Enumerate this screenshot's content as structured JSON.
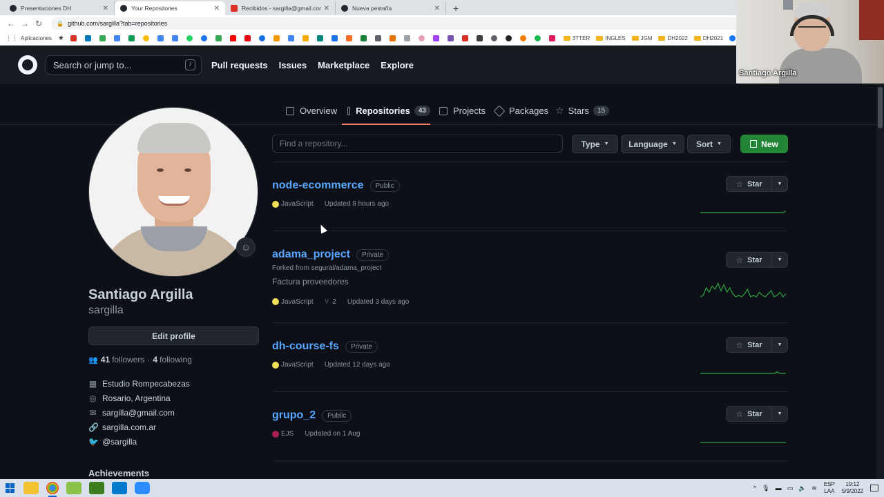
{
  "browser": {
    "tabs": [
      {
        "label": "Presentaciones DH",
        "icon": "github-icon",
        "color": "#24292f",
        "active": false
      },
      {
        "label": "Your Repositories",
        "icon": "github-icon",
        "color": "#24292f",
        "active": true
      },
      {
        "label": "Recibidos - sargilla@gmail.com",
        "icon": "gmail-icon",
        "color": "#d93025",
        "active": false
      },
      {
        "label": "Nueva pestaña",
        "icon": "github-icon",
        "color": "#24292f",
        "active": false
      }
    ],
    "new_tab": "+",
    "close": "✕",
    "url": "github.com/sargilla?tab=repositories",
    "bookmarks": {
      "apps_label": "Aplicaciones",
      "folders": [
        "3TTER",
        "INGLES",
        "JGM",
        "DH2022",
        "DH2021"
      ]
    }
  },
  "github": {
    "search_placeholder": "Search or jump to...",
    "search_key": "/",
    "nav": [
      "Pull requests",
      "Issues",
      "Marketplace",
      "Explore"
    ],
    "profile_tabs": [
      {
        "label": "Overview",
        "count": null
      },
      {
        "label": "Repositories",
        "count": "43"
      },
      {
        "label": "Projects",
        "count": null
      },
      {
        "label": "Packages",
        "count": null
      },
      {
        "label": "Stars",
        "count": "15"
      }
    ]
  },
  "webcam": {
    "name": "Santiago Argilla"
  },
  "profile": {
    "name": "Santiago Argilla",
    "login": "sargilla",
    "edit_label": "Edit profile",
    "followers": "41",
    "followers_label": "followers",
    "following": "4",
    "following_label": "following",
    "dot": "·",
    "company": "Estudio Rompecabezas",
    "location": "Rosario, Argentina",
    "email": "sargilla@gmail.com",
    "website": "sargilla.com.ar",
    "twitter": "@sargilla",
    "achievements": "Achievements"
  },
  "repo_controls": {
    "find_placeholder": "Find a repository...",
    "type_label": "Type",
    "language_label": "Language",
    "sort_label": "Sort",
    "new_label": "New"
  },
  "repos": [
    {
      "name": "node-ecommerce",
      "visibility": "Public",
      "forked_from": "",
      "description": "",
      "language": "JavaScript",
      "lang_color": "#f1e05a",
      "forks": "",
      "updated": "Updated 8 hours ago",
      "star_label": "Star",
      "spark": [
        0,
        0,
        0,
        0,
        0,
        0,
        0,
        0,
        0,
        0,
        0,
        0,
        0,
        0,
        0,
        0,
        0,
        0,
        0,
        0,
        0,
        0,
        0,
        0,
        0,
        0,
        0,
        0,
        0,
        1
      ]
    },
    {
      "name": "adama_project",
      "visibility": "Private",
      "forked_from": "Forked from segural/adama_project",
      "description": "Factura proveedores",
      "language": "JavaScript",
      "lang_color": "#f1e05a",
      "forks": "2",
      "updated": "Updated 3 days ago",
      "star_label": "Star",
      "spark": [
        0,
        1,
        6,
        3,
        7,
        5,
        9,
        4,
        8,
        3,
        6,
        2,
        0,
        1,
        0,
        2,
        5,
        0,
        1,
        0,
        3,
        1,
        0,
        2,
        4,
        0,
        1,
        3,
        0,
        2
      ]
    },
    {
      "name": "dh-course-fs",
      "visibility": "Private",
      "forked_from": "",
      "description": "",
      "language": "JavaScript",
      "lang_color": "#f1e05a",
      "forks": "",
      "updated": "Updated 12 days ago",
      "star_label": "Star",
      "spark": [
        0,
        0,
        0,
        0,
        0,
        0,
        0,
        0,
        0,
        0,
        0,
        0,
        0,
        0,
        0,
        0,
        0,
        0,
        0,
        0,
        0,
        0,
        0,
        0,
        0,
        0,
        1,
        0,
        0,
        0
      ]
    },
    {
      "name": "grupo_2",
      "visibility": "Public",
      "forked_from": "",
      "description": "",
      "language": "EJS",
      "lang_color": "#a91e50",
      "forks": "",
      "updated": "Updated on 1 Aug",
      "star_label": "Star",
      "spark": [
        0,
        0,
        0,
        0,
        0,
        0,
        0,
        0,
        0,
        0,
        0,
        0,
        0,
        0,
        0,
        0,
        0,
        0,
        0,
        0,
        0,
        0,
        0,
        0,
        0,
        0,
        0,
        0,
        0,
        0
      ]
    }
  ],
  "taskbar": {
    "lang_top": "ESP",
    "lang_bottom": "LAA",
    "time": "19:12",
    "date": "5/9/2022"
  },
  "colors": {
    "accent_green": "#238636",
    "link_blue": "#58a6ff",
    "tab_underline": "#f78166",
    "spark_green": "#2ea043"
  }
}
